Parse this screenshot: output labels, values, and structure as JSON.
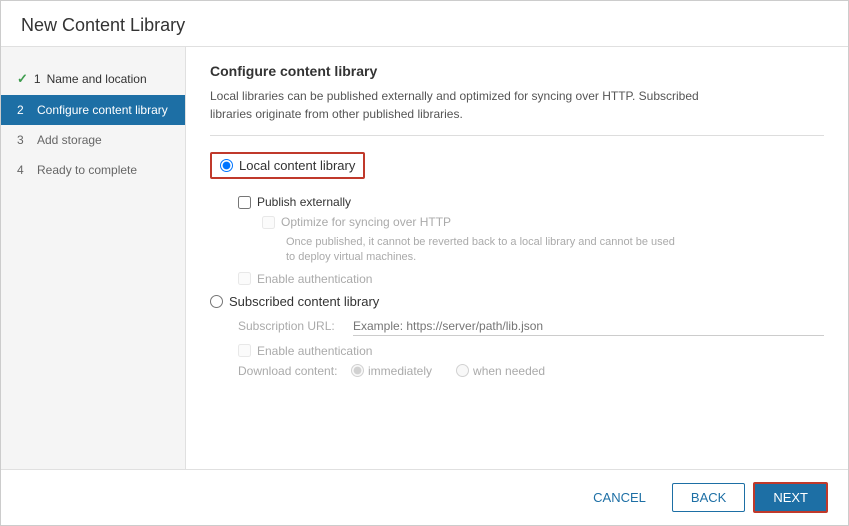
{
  "dialog": {
    "title": "New Content Library"
  },
  "sidebar": {
    "items": [
      {
        "id": "step1",
        "label": "Name and location",
        "number": "1",
        "state": "completed"
      },
      {
        "id": "step2",
        "label": "Configure content library",
        "number": "2",
        "state": "active"
      },
      {
        "id": "step3",
        "label": "Add storage",
        "number": "3",
        "state": "pending"
      },
      {
        "id": "step4",
        "label": "Ready to complete",
        "number": "4",
        "state": "pending"
      }
    ]
  },
  "main": {
    "section_title": "Configure content library",
    "description_line1": "Local libraries can be published externally and optimized for syncing over HTTP. Subscribed",
    "description_line2": "libraries originate from other published libraries.",
    "local_option_label": "Local content library",
    "publish_externally_label": "Publish externally",
    "optimize_http_label": "Optimize for syncing over HTTP",
    "optimize_note_line1": "Once published, it cannot be reverted back to a local library and cannot be used",
    "optimize_note_line2": "to deploy virtual machines.",
    "enable_auth_local_label": "Enable authentication",
    "subscribed_option_label": "Subscribed content library",
    "subscription_url_label": "Subscription URL:",
    "subscription_url_placeholder": "Example: https://server/path/lib.json",
    "enable_auth_sub_label": "Enable authentication",
    "download_content_label": "Download content:",
    "immediately_label": "immediately",
    "when_needed_label": "when needed"
  },
  "footer": {
    "cancel_label": "CANCEL",
    "back_label": "BACK",
    "next_label": "NEXT"
  }
}
